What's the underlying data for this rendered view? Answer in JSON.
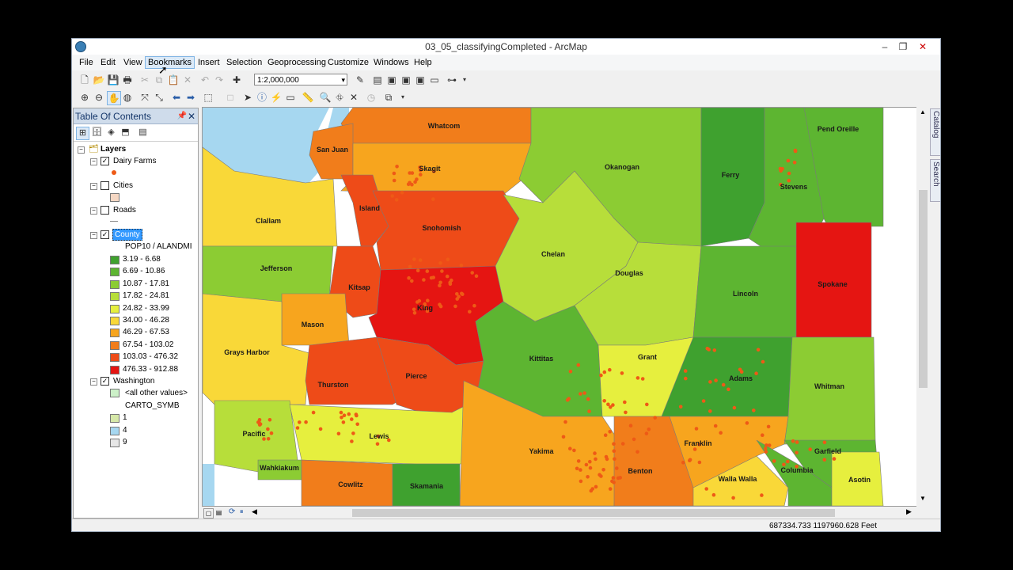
{
  "window": {
    "title": "03_05_classifyingCompleted - ArcMap"
  },
  "menu": [
    "File",
    "Edit",
    "View",
    "Bookmarks",
    "Insert",
    "Selection",
    "Geoprocessing",
    "Customize",
    "Windows",
    "Help"
  ],
  "toolbar": {
    "scale": "1:2,000,000"
  },
  "toc": {
    "title": "Table Of Contents",
    "layers_label": "Layers",
    "dairy": "Dairy Farms",
    "cities": "Cities",
    "roads": "Roads",
    "county": "County",
    "field_label": "POP10 / ALANDMI",
    "classes": [
      {
        "label": "3.19 - 6.68",
        "color": "#3fa12f"
      },
      {
        "label": "6.69 - 10.86",
        "color": "#5db531"
      },
      {
        "label": "10.87 - 17.81",
        "color": "#8ccc33"
      },
      {
        "label": "17.82 - 24.81",
        "color": "#b7de3a"
      },
      {
        "label": "24.82 - 33.99",
        "color": "#e6ef3e"
      },
      {
        "label": "34.00 - 46.28",
        "color": "#f9d838"
      },
      {
        "label": "46.29 - 67.53",
        "color": "#f7a51e"
      },
      {
        "label": "67.54 - 103.02",
        "color": "#f17d1b"
      },
      {
        "label": "103.03 - 476.32",
        "color": "#ee4b18"
      },
      {
        "label": "476.33 - 912.88",
        "color": "#e51512"
      }
    ],
    "washington": "Washington",
    "all_other": "<all other values>",
    "carto_field": "CARTO_SYMB",
    "carto_values": [
      {
        "label": "1",
        "color": "#d6e8a8"
      },
      {
        "label": "4",
        "color": "#a6d7f0"
      },
      {
        "label": "9",
        "color": "#e6e6e6"
      }
    ]
  },
  "sidetabs": {
    "catalog": "Catalog",
    "search": "Search"
  },
  "status": {
    "coords": "687334.733  1197960.628 Feet"
  },
  "counties": [
    "Whatcom",
    "San Juan",
    "Skagit",
    "Okanogan",
    "Ferry",
    "Stevens",
    "Pend Oreille",
    "Clallam",
    "Island",
    "Snohomish",
    "Chelan",
    "Jefferson",
    "Kitsap",
    "King",
    "Douglas",
    "Lincoln",
    "Spokane",
    "Mason",
    "Grays Harbor",
    "Kittitas",
    "Grant",
    "Adams",
    "Whitman",
    "Thurston",
    "Pierce",
    "Pacific",
    "Lewis",
    "Yakima",
    "Franklin",
    "Garfield",
    "Wahkiakum",
    "Cowlitz",
    "Skamania",
    "Benton",
    "Walla Walla",
    "Columbia",
    "Asotin"
  ]
}
